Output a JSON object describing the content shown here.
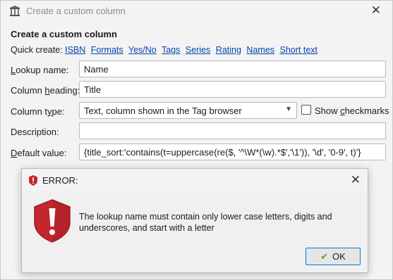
{
  "window": {
    "title": "Create a custom column"
  },
  "form": {
    "heading": "Create a custom column",
    "quick_create_label": "Quick create:",
    "quick_links": [
      "ISBN",
      "Formats",
      "Yes/No",
      "Tags",
      "Series",
      "Rating",
      "Names",
      "Short text"
    ],
    "lookup_name": {
      "label_hot": "L",
      "label_rest": "ookup name:",
      "value": "Name"
    },
    "column_heading": {
      "label_pre": "Column ",
      "label_hot": "h",
      "label_rest": "eading:",
      "value": "Title"
    },
    "column_type": {
      "label_pre": "Column t",
      "label_hot": "y",
      "label_rest": "pe:",
      "value": "Text, column shown in the Tag browser"
    },
    "show_checkmarks": {
      "label_pre": "Show ",
      "label_hot": "c",
      "label_rest": "heckmarks",
      "checked": false
    },
    "description": {
      "label": "Description:",
      "value": ""
    },
    "default_value": {
      "label_hot": "D",
      "label_rest": "efault value:",
      "value": "{title_sort:'contains(t=uppercase(re($, '^\\W*(\\w).*$','\\1')), '\\d', '0-9', t)'}"
    }
  },
  "error_dialog": {
    "title": "ERROR:",
    "message": "The lookup name must contain only lower case letters, digits and underscores, and start with a letter",
    "ok_label": "OK",
    "accent_color": "#c4262e"
  }
}
